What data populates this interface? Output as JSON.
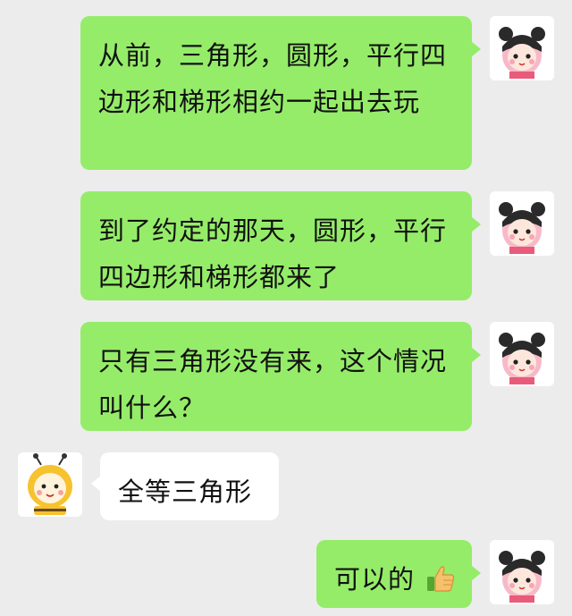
{
  "messages": [
    {
      "side": "right",
      "text": "从前，三角形，圆形，平行四边形和梯形相约一起出去玩"
    },
    {
      "side": "right",
      "text": "到了约定的那天，圆形，平行四边形和梯形都来了"
    },
    {
      "side": "right",
      "text": "只有三角形没有来，这个情况叫什么？"
    },
    {
      "side": "left",
      "text": "全等三角形"
    },
    {
      "side": "right",
      "text": "可以的",
      "emoji": "thumbs-up-icon"
    }
  ],
  "avatars": {
    "me": "panda-girl-avatar",
    "friend": "bee-baby-avatar"
  }
}
